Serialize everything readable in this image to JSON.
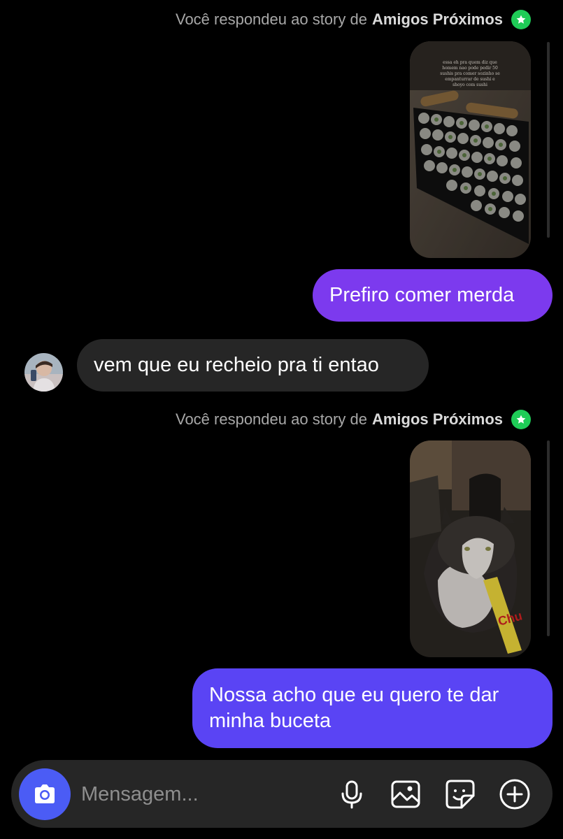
{
  "thread": [
    {
      "type": "story_reply",
      "prefix": "Você respondeu ao story de",
      "target": "Amigos Próximos",
      "badge_icon": "star-icon",
      "story_caption": "essa eh pra quem diz que homem nao pode pedir 50 sushis pra comer sozinho se empanturrar de sushi e shoyo com sushi",
      "story_subject": "sushi-tray-photo"
    },
    {
      "type": "sent",
      "text": "Prefiro comer merda",
      "color": "#7c3aee"
    },
    {
      "type": "received",
      "text": "vem que eu recheio pra ti entao",
      "color": "#262626",
      "avatar_icon": "user-avatar"
    },
    {
      "type": "story_reply",
      "prefix": "Você respondeu ao story de",
      "target": "Amigos Próximos",
      "badge_icon": "star-icon",
      "story_subject": "cat-eating-treat-photo",
      "story_text": "Chu"
    },
    {
      "type": "sent",
      "text": "Nossa acho que eu quero te dar minha buceta",
      "color": "#5a44f4"
    }
  ],
  "composer": {
    "placeholder": "Mensagem...",
    "value": "",
    "icons": [
      "camera-icon",
      "microphone-icon",
      "gallery-icon",
      "sticker-icon",
      "plus-icon"
    ],
    "camera_color": "#4b5cf5"
  },
  "colors": {
    "background": "#000000",
    "close_friends_green": "#1fcc57"
  }
}
